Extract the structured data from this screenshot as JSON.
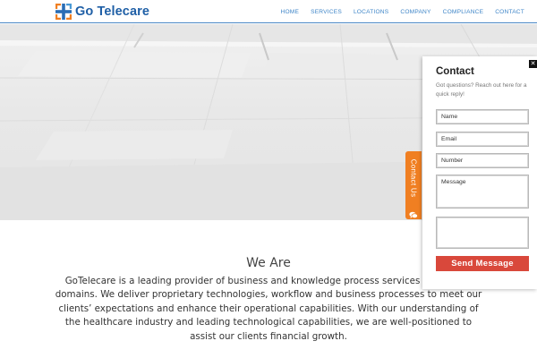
{
  "brand": {
    "name": "Go Telecare",
    "logo_icon": "cross-arrows-logo-icon",
    "colors": {
      "blue": "#1f5fa6",
      "orange": "#f07f22"
    }
  },
  "nav": {
    "items": [
      {
        "label": "HOME"
      },
      {
        "label": "SERVICES"
      },
      {
        "label": "LOCATIONS"
      },
      {
        "label": "COMPANY"
      },
      {
        "label": "COMPLIANCE"
      },
      {
        "label": "CONTACT"
      }
    ],
    "color": "#3f86c8"
  },
  "about": {
    "title": "We Are",
    "text": "GoTelecare is a leading provider of business and knowledge process services in multiple domains. We deliver proprietary technologies, workflow and business processes to meet our clients’ expectations and enhance their operational capabilities. With our understanding of the healthcare industry and leading technological capabilities, we are well-positioned to assist our clients financial growth."
  },
  "contact_tab": {
    "label": "Contact Us",
    "icon": "chat-bubble-icon",
    "color": "#f07f22"
  },
  "contact_panel": {
    "title": "Contact",
    "subtitle": "Got questions? Reach out here for a quick reply!",
    "close_icon": "close-icon",
    "close_symbol": "✕",
    "fields": {
      "name_placeholder": "Name",
      "email_placeholder": "Email",
      "number_placeholder": "Number",
      "message_placeholder": "Message"
    },
    "submit_label": "Send Message",
    "submit_color": "#d9483b"
  }
}
